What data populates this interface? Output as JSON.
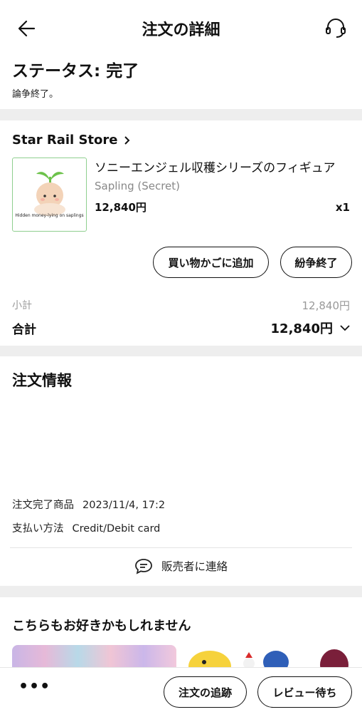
{
  "header": {
    "title": "注文の詳細"
  },
  "status": {
    "title": "ステータス: 完了",
    "subtitle": "論争終了。"
  },
  "store": {
    "name": "Star Rail Store"
  },
  "product": {
    "title": "ソニーエンジェル収穫シリーズのフィギュア",
    "variant": "Sapling (Secret)",
    "price": "12,840円",
    "quantity": "x1",
    "image_caption": "Hidden money-lying on saplings"
  },
  "actions": {
    "add_to_cart": "買い物かごに追加",
    "dispute_end": "紛争終了"
  },
  "summary": {
    "subtotal_label": "小計",
    "subtotal_value": "12,840円",
    "total_label": "合計",
    "total_value": "12,840円"
  },
  "order_info": {
    "title": "注文情報",
    "completed_label": "注文完了商品",
    "completed_value": "2023/11/4, 17:2",
    "payment_label": "支払い方法",
    "payment_value": "Credit/Debit card",
    "contact_label": "販売者に連絡"
  },
  "recommendations": {
    "title": "こちらもお好きかもしれません"
  },
  "bottom_bar": {
    "more": "•••",
    "track": "注文の追跡",
    "review": "レビュー待ち"
  },
  "colors": {
    "accent_border": "#8fcf8f",
    "section_gap": "#eeeeee",
    "muted_text": "#999999"
  }
}
